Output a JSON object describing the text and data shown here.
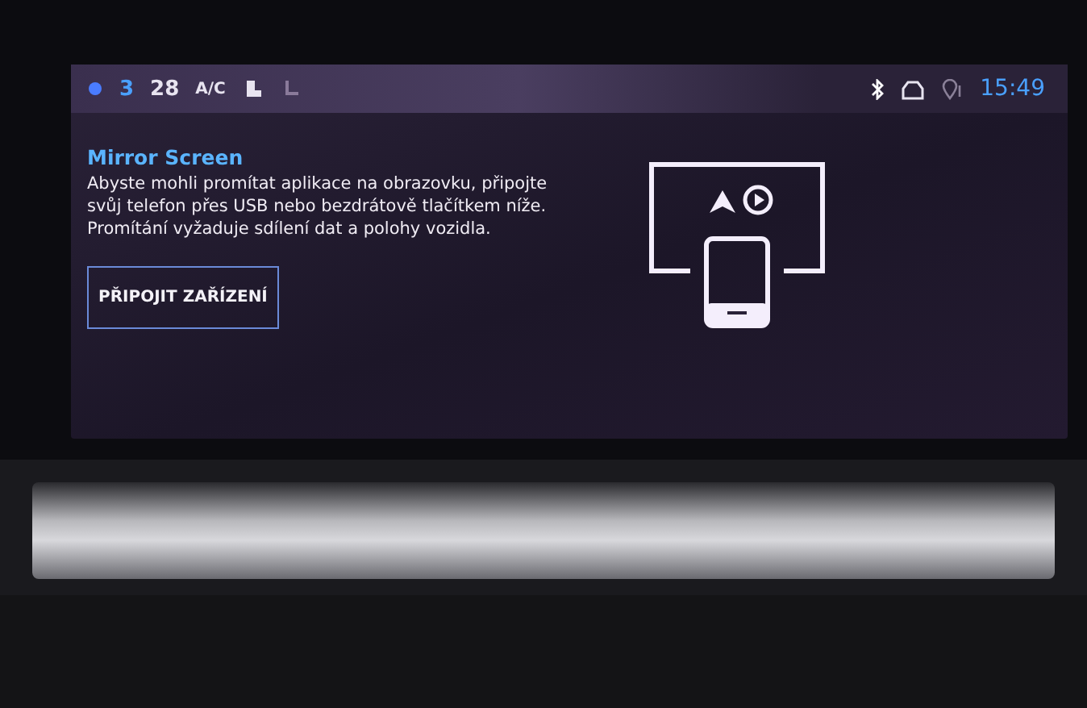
{
  "status_bar": {
    "fan_level": "3",
    "temperature": "28",
    "ac": "A/C",
    "time": "15:49"
  },
  "mirror_screen": {
    "title": "Mirror Screen",
    "description": "Abyste mohli promítat aplikace na obrazovku, připojte svůj telefon přes USB nebo bezdrátově tlačítkem níže. Promítání vyžaduje sdílení dat a polohy vozidla.",
    "button": "PŘIPOJIT ZAŘÍZENÍ"
  }
}
